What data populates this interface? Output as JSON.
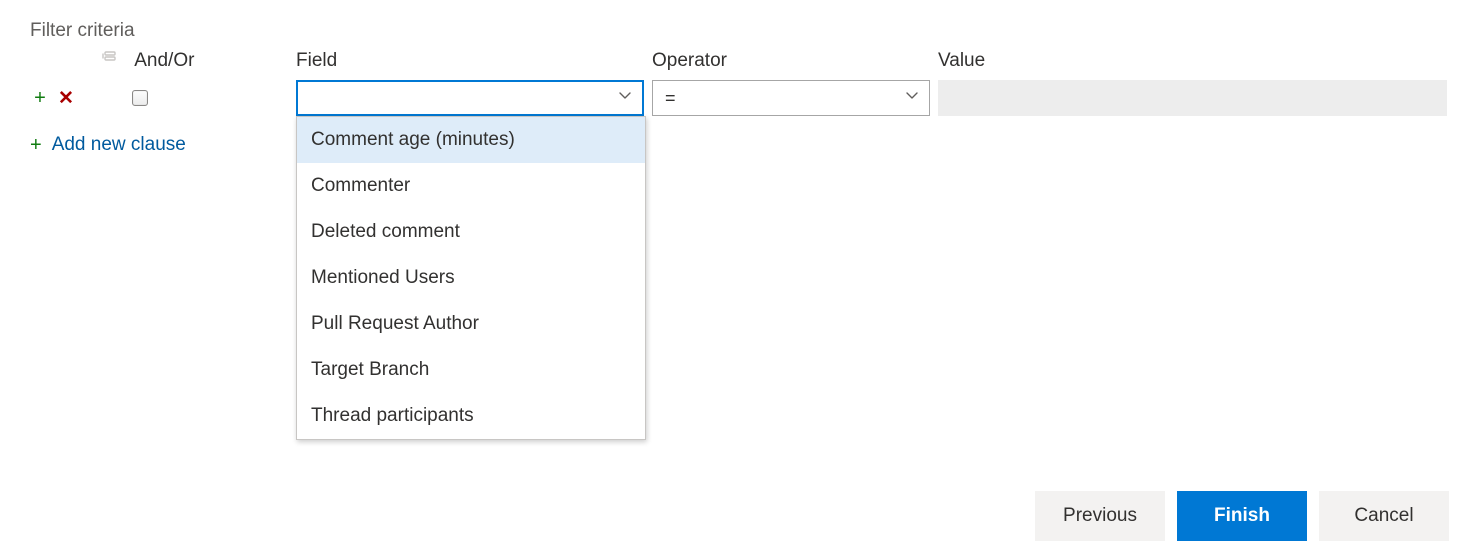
{
  "title": "Filter criteria",
  "columns": {
    "andor": "And/Or",
    "field": "Field",
    "operator": "Operator",
    "value": "Value"
  },
  "clause": {
    "andor_checked": false,
    "field": "",
    "operator": "=",
    "value": ""
  },
  "field_dropdown": {
    "highlighted_index": 0,
    "options": [
      "Comment age (minutes)",
      "Commenter",
      "Deleted comment",
      "Mentioned Users",
      "Pull Request Author",
      "Target Branch",
      "Thread participants"
    ]
  },
  "add_clause_label": "Add new clause",
  "buttons": {
    "previous": "Previous",
    "finish": "Finish",
    "cancel": "Cancel"
  },
  "icons": {
    "add": "+",
    "remove": "✕"
  }
}
